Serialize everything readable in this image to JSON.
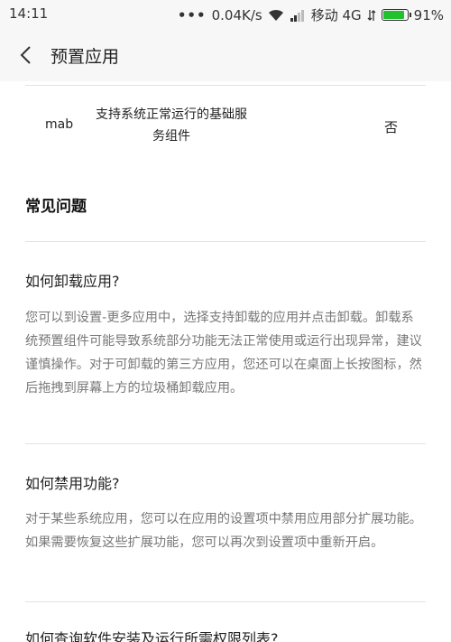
{
  "status_bar": {
    "time": "14:11",
    "signal_dots": "•••",
    "speed": "0.04K/s",
    "carrier": "移动 4G",
    "battery": "91%",
    "battery_level": 0.91,
    "battery_color": "#21c12f"
  },
  "header": {
    "title": "预置应用"
  },
  "app_row": {
    "name": "mab",
    "description": "支持系统正常运行的基础服务组件",
    "can_uninstall": "否"
  },
  "faq": {
    "section_title": "常见问题",
    "items": [
      {
        "question": "如何卸载应用?",
        "answer": "您可以到设置-更多应用中，选择支持卸载的应用并点击卸载。卸载系统预置组件可能导致系统部分功能无法正常使用或运行出现异常，建议谨慎操作。对于可卸载的第三方应用，您还可以在桌面上长按图标，然后拖拽到屏幕上方的垃圾桶卸载应用。"
      },
      {
        "question": "如何禁用功能?",
        "answer": "对于某些系统应用，您可以在应用的设置项中禁用应用部分扩展功能。如果需要恢复这些扩展功能，您可以再次到设置项中重新开启。"
      },
      {
        "question": "如何查询软件安装及运行所需权限列表?",
        "answer": ""
      }
    ]
  }
}
